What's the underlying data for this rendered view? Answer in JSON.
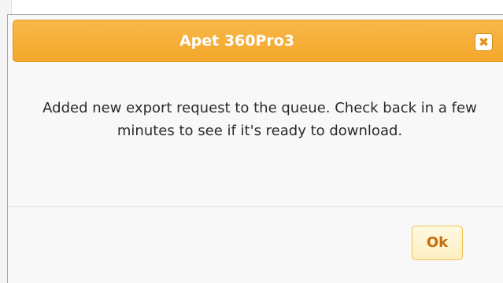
{
  "dialog": {
    "title": "Apet 360Pro3",
    "close_glyph": "✖",
    "close_icon": "close-icon",
    "message": "Added new export request to the queue. Check back in a few minutes to see if it's ready to download.",
    "ok_label": "Ok"
  },
  "colors": {
    "titlebar": "#f4a62a",
    "ok_text": "#c56d0d",
    "ok_border": "#f0c24c"
  }
}
